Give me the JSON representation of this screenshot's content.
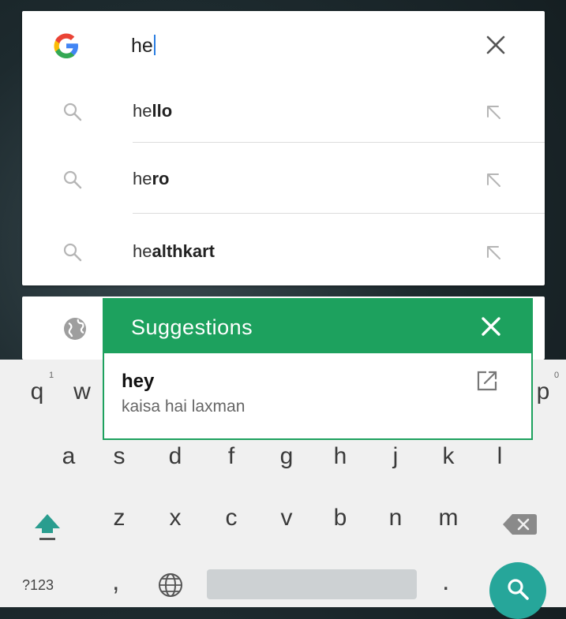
{
  "search": {
    "query": "he",
    "suggestions": [
      {
        "prefix": "he",
        "rest": "llo"
      },
      {
        "prefix": "he",
        "rest": "ro"
      },
      {
        "prefix": "he",
        "rest": "althkart"
      }
    ]
  },
  "keyboard": {
    "row1_visible": [
      "q",
      "w",
      "p"
    ],
    "row1_hints": {
      "q": "1",
      "p": "0"
    },
    "row2": [
      "a",
      "s",
      "d",
      "f",
      "g",
      "h",
      "j",
      "k",
      "l"
    ],
    "row3": [
      "z",
      "x",
      "c",
      "v",
      "b",
      "n",
      "m"
    ],
    "symbols_label": "?123",
    "comma": ",",
    "period": "."
  },
  "popup": {
    "title": "Suggestions",
    "item_title": "hey",
    "item_subtitle": "kaisa hai laxman"
  },
  "colors": {
    "popup_accent": "#1da15e",
    "search_key": "#26a69a",
    "caret": "#2a7de1"
  },
  "icons": {
    "logo": "google-g-icon",
    "clear": "close-icon",
    "suggestion": "search-icon",
    "fill": "arrow-up-left-icon",
    "second_card": "globe-icon",
    "popup_close": "close-icon",
    "popup_open": "open-external-icon",
    "shift": "shift-icon",
    "backspace": "backspace-icon",
    "language": "globe-icon",
    "submit": "search-icon"
  }
}
